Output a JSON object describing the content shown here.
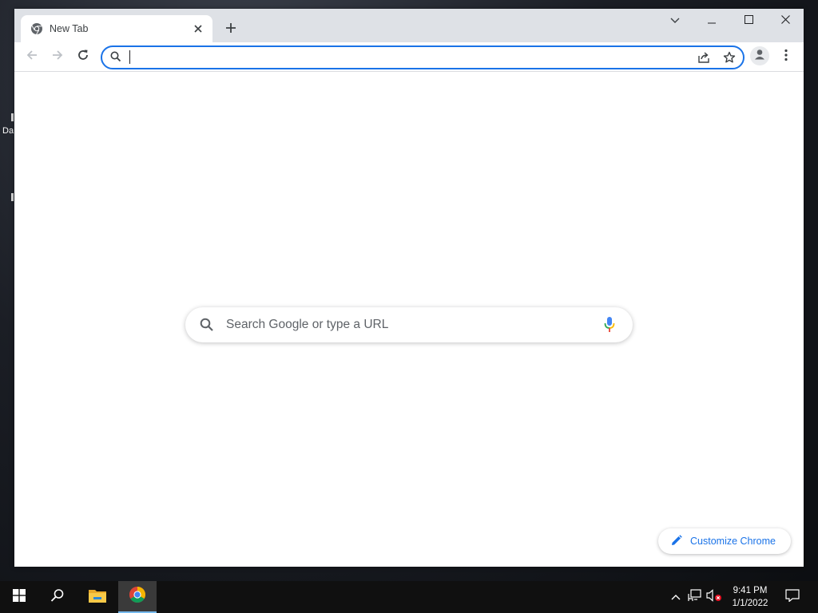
{
  "desktop": {
    "fragment_label": "Da"
  },
  "browser": {
    "tab": {
      "title": "New Tab",
      "favicon": "chrome-icon"
    },
    "new_tab_icon": "plus-icon",
    "window_controls": [
      "tab-search-icon",
      "minimize-icon",
      "maximize-icon",
      "close-icon"
    ],
    "omnibox": {
      "value": "",
      "placeholder": ""
    },
    "colors": {
      "accent": "#1a73e8",
      "tabstrip": "#dee1e6"
    }
  },
  "ntp": {
    "search_placeholder": "Search Google or type a URL",
    "customize_label": "Customize Chrome"
  },
  "taskbar": {
    "items": [
      "windows-start-icon",
      "search-icon",
      "file-explorer-icon",
      "chrome-icon"
    ],
    "tray": [
      "show-hidden-icons-chevron",
      "network-icon",
      "volume-muted-icon"
    ],
    "time": "9:41 PM",
    "date": "1/1/2022"
  }
}
